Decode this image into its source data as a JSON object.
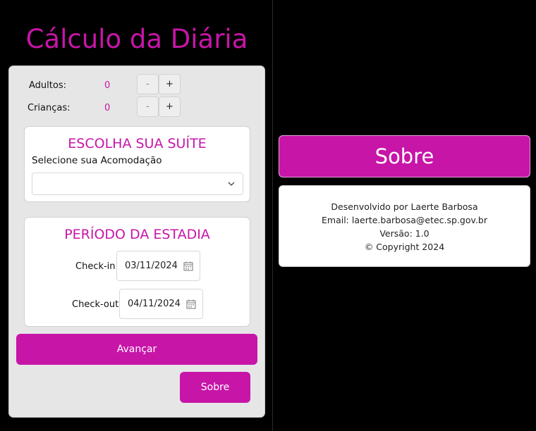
{
  "app": {
    "title": "Cálculo da Diária"
  },
  "guests": {
    "adults_label": "Adultos:",
    "adults_value": "0",
    "children_label": "Crianças:",
    "children_value": "0",
    "minus_label": "-",
    "plus_label": "+"
  },
  "suite": {
    "heading": "ESCOLHA SUA SUÍTE",
    "prompt": "Selecione sua Acomodação",
    "selected": ""
  },
  "stay": {
    "heading": "PERÍODO DA ESTADIA",
    "checkin_label": "Check-in:",
    "checkin_value": "03/11/2024",
    "checkout_label": "Check-out:",
    "checkout_value": "04/11/2024"
  },
  "actions": {
    "next_label": "Avançar",
    "about_label": "Sobre"
  },
  "about": {
    "heading": "Sobre",
    "developer": "Desenvolvido por Laerte Barbosa",
    "email": "Email: laerte.barbosa@etec.sp.gov.br",
    "version": "Versão: 1.0",
    "copyright": "© Copyright 2024"
  },
  "colors": {
    "accent": "#c715a8",
    "panel": "#e6e6e6",
    "background": "#000000"
  },
  "icons": [
    "chevron-down-icon",
    "calendar-icon"
  ]
}
